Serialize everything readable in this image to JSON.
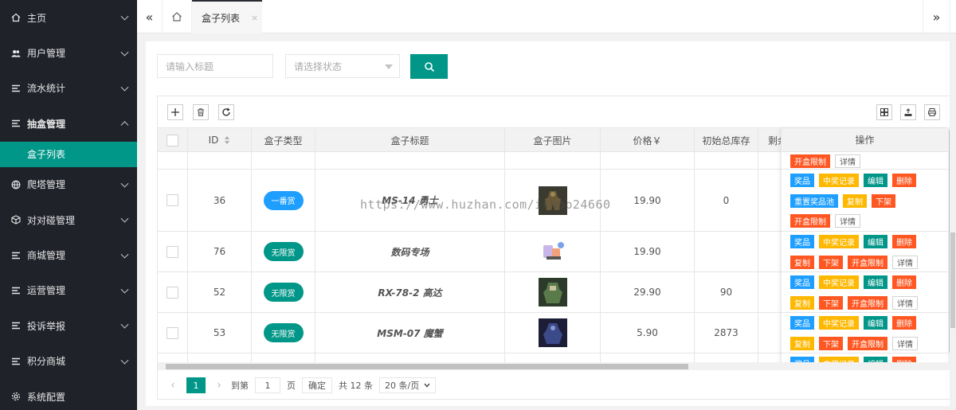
{
  "sidebar": {
    "items": [
      {
        "label": "主页",
        "icon": "home-icon"
      },
      {
        "label": "用户管理",
        "icon": "users-icon"
      },
      {
        "label": "流水统计",
        "icon": "list-icon"
      },
      {
        "label": "抽盒管理",
        "icon": "list-icon",
        "open": true
      },
      {
        "label": "爬塔管理",
        "icon": "globe-icon"
      },
      {
        "label": "对对碰管理",
        "icon": "box-icon"
      },
      {
        "label": "商城管理",
        "icon": "list-icon"
      },
      {
        "label": "运营管理",
        "icon": "list-icon"
      },
      {
        "label": "投诉举报",
        "icon": "list-icon"
      },
      {
        "label": "积分商城",
        "icon": "list-icon"
      },
      {
        "label": "系统配置",
        "icon": "gear-icon"
      }
    ],
    "submenu": {
      "label": "盒子列表"
    }
  },
  "tabs": {
    "active_label": "盒子列表",
    "close_glyph": "×"
  },
  "filters": {
    "title_placeholder": "请输入标题",
    "status_placeholder": "请选择状态"
  },
  "table": {
    "columns": {
      "id": "ID",
      "type": "盒子类型",
      "title": "盒子标题",
      "image": "盒子图片",
      "price": "价格￥",
      "stock": "初始总库存",
      "remain": "剩余",
      "ops": "操作"
    },
    "rows": [
      {
        "id": "36",
        "type": "一番赏",
        "type_color": "#1e9fff",
        "title": "MS-14 勇士",
        "price": "19.90",
        "stock": "0"
      },
      {
        "id": "76",
        "type": "无限赏",
        "type_color": "#009688",
        "title": "数码专场",
        "price": "19.90",
        "stock": ""
      },
      {
        "id": "52",
        "type": "无限赏",
        "type_color": "#009688",
        "title": "RX-78-2 高达",
        "price": "29.90",
        "stock": "90"
      },
      {
        "id": "53",
        "type": "无限赏",
        "type_color": "#009688",
        "title": "MSM-07 魔蟹",
        "price": "5.90",
        "stock": "2873"
      }
    ],
    "ops": {
      "limit": "开盒限制",
      "detail": "详情",
      "prize": "奖品",
      "records": "中奖记录",
      "edit": "编辑",
      "delete": "删除",
      "reset_pool": "重置奖品池",
      "copy": "复制",
      "offline": "下架"
    }
  },
  "pager": {
    "current": "1",
    "goto_label": "到第",
    "goto_value": "1",
    "page_unit": "页",
    "confirm": "确定",
    "total": "共 12 条",
    "page_size": "20 条/页"
  },
  "watermark": "https://www.huzhan.com/ishop24660"
}
